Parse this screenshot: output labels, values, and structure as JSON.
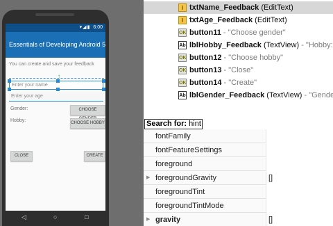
{
  "phone": {
    "status_time": "6:00",
    "status_icons": "▾◢▮",
    "app_title": "Essentials of Developing Android 5.0",
    "subtitle": "You can create and save your feedback",
    "name_hint": "Enter your name",
    "age_hint": "Enter your age",
    "gender_label": "Gender:",
    "hobby_label": "Hobby:",
    "choose_gender": "CHOOSE GENDER",
    "choose_hobby": "CHOOSE HOBBY",
    "close": "CLOSE",
    "create": "CREATE",
    "nav_back": "◁",
    "nav_home": "○",
    "nav_recent": "□"
  },
  "tree": {
    "items": [
      {
        "name": "txtName_Feedback",
        "type": "(EditText)",
        "desc": "",
        "icon": "edittext-icon",
        "glyph": "I",
        "selected": true
      },
      {
        "name": "txtAge_Feedback",
        "type": "(EditText)",
        "desc": "",
        "icon": "edittext-icon",
        "glyph": "I",
        "selected": false
      },
      {
        "name": "button11",
        "type": "",
        "desc": "- \"Choose gender\"",
        "icon": "button-icon",
        "glyph": "OK",
        "selected": false
      },
      {
        "name": "lblHobby_Feedback",
        "type": "(TextView)",
        "desc": "- \"Hobby:\"",
        "icon": "textview-icon",
        "glyph": "Ab",
        "selected": false
      },
      {
        "name": "button12",
        "type": "",
        "desc": "- \"Choose hobby\"",
        "icon": "button-icon",
        "glyph": "OK",
        "selected": false
      },
      {
        "name": "button13",
        "type": "",
        "desc": "- \"Close\"",
        "icon": "button-icon",
        "glyph": "OK",
        "selected": false
      },
      {
        "name": "button14",
        "type": "",
        "desc": "- \"Create\"",
        "icon": "button-icon",
        "glyph": "OK",
        "selected": false
      },
      {
        "name": "lblGender_Feedback",
        "type": "(TextView)",
        "desc": "- \"Gender:\"",
        "icon": "textview-icon",
        "glyph": "Ab",
        "selected": false
      }
    ]
  },
  "search": {
    "label": "Search for:",
    "value": "hint"
  },
  "properties": [
    {
      "name": "fontFamily",
      "value": "",
      "bold": false,
      "expandable": false
    },
    {
      "name": "fontFeatureSettings",
      "value": "",
      "bold": false,
      "expandable": false
    },
    {
      "name": "foreground",
      "value": "",
      "bold": false,
      "expandable": false
    },
    {
      "name": "foregroundGravity",
      "value": "[]",
      "bold": false,
      "expandable": true
    },
    {
      "name": "foregroundTint",
      "value": "",
      "bold": false,
      "expandable": false
    },
    {
      "name": "foregroundTintMode",
      "value": "",
      "bold": false,
      "expandable": false
    },
    {
      "name": "gravity",
      "value": "[]",
      "bold": true,
      "expandable": true
    }
  ],
  "colors": {
    "action_bar": "#1a6fb5",
    "status_bar": "#0d4f86",
    "selection": "#2b8ad8",
    "tree_selected": "#d7d7d7"
  }
}
